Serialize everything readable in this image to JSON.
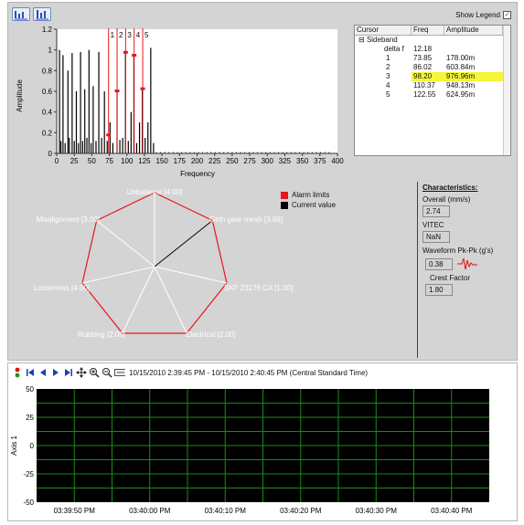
{
  "toolbar": {
    "show_legend_label": "Show Legend",
    "show_legend_checked": true,
    "buttons": [
      {
        "icon": "autoscale-x-icon"
      },
      {
        "icon": "autoscale-y-icon"
      }
    ]
  },
  "spectrum": {
    "y_label": "Amplitude",
    "x_label": "Frequency",
    "y_ticks": [
      "1.2",
      "1",
      "0.8",
      "0.6",
      "0.4",
      "0.2",
      "0"
    ],
    "x_ticks": [
      "0",
      "25",
      "50",
      "75",
      "100",
      "125",
      "150",
      "175",
      "200",
      "225",
      "250",
      "275",
      "300",
      "325",
      "350",
      "375",
      "400"
    ],
    "cursor_labels": [
      "1",
      "2",
      "3",
      "4",
      "5"
    ],
    "cursor_freqs": [
      73.85,
      86.02,
      98.2,
      110.37,
      122.55
    ]
  },
  "cursor_table": {
    "headers": [
      "Cursor",
      "Freq",
      "Amplitude"
    ],
    "rows": [
      {
        "name": "Sideband",
        "freq": "",
        "amp": ""
      },
      {
        "name": "delta f",
        "freq": "12.18",
        "amp": ""
      },
      {
        "name": "1",
        "freq": "73.85",
        "amp": "178.00m"
      },
      {
        "name": "2",
        "freq": "86.02",
        "amp": "603.84m"
      },
      {
        "name": "3",
        "freq": "98.20",
        "amp": "976.96m"
      },
      {
        "name": "4",
        "freq": "110.37",
        "amp": "948.13m"
      },
      {
        "name": "5",
        "freq": "122.55",
        "amp": "624.95m"
      }
    ]
  },
  "radar": {
    "axes": [
      "Unbalance [4.00]",
      "Girth gear-mesh [3.99]",
      "SKF 23176 CA [1.00]",
      "Electrical [2.00]",
      "Rubbing [2.00]",
      "Looseness [4.00]",
      "Misalignment [3.00]"
    ],
    "legend": [
      {
        "label": "Alarm limits",
        "color": "#e8161a"
      },
      {
        "label": "Current value",
        "color": "#000000"
      }
    ],
    "colors": {
      "alarm": "#e8161a",
      "current": "#000000",
      "spokes": "#ffffff"
    }
  },
  "characteristics": {
    "title": "Characteristics:",
    "overall_label": "Overall (mm/s)",
    "overall_value": "2.74",
    "vitec_label": "VITEC",
    "vitec_value": "NaN",
    "waveform_label": "Waveform Pk-Pk (g's)",
    "waveform_value": "0.38",
    "crest_label": "Crest Factor",
    "crest_value": "1.80"
  },
  "trend": {
    "time_range": "10/15/2010 2:39:45 PM - 10/15/2010 2:40:45 PM (Central Standard Time)",
    "y_label": "Axis 1",
    "y_ticks": [
      "50",
      "25",
      "0",
      "-25",
      "-50"
    ],
    "x_ticks": [
      "03:39:50 PM",
      "03:40:00 PM",
      "03:40:10 PM",
      "03:40:20 PM",
      "03:40:30 PM",
      "03:40:40 PM"
    ],
    "plot_bg": "#000000",
    "grid_color": "#1a8a1a"
  }
}
